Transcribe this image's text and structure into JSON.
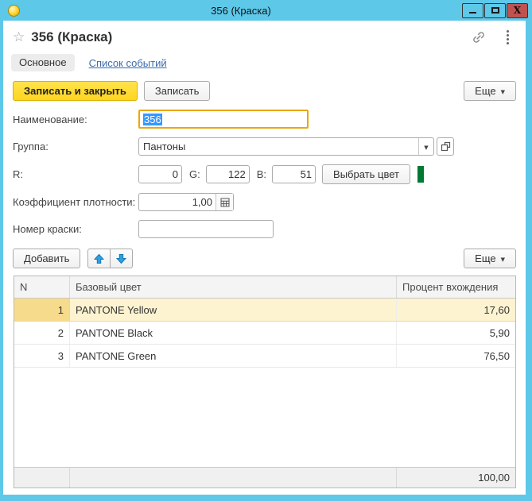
{
  "window": {
    "title": "356 (Краска)"
  },
  "header": {
    "title": "356 (Краска)"
  },
  "icons": {
    "star": "☆",
    "caret": "▼"
  },
  "tabs": [
    {
      "label": "Основное"
    },
    {
      "label": "Список событий"
    }
  ],
  "command_bar": {
    "save_and_close": "Записать и закрыть",
    "save": "Записать",
    "more": "Еще"
  },
  "form": {
    "fields": {
      "name": {
        "label": "Наименование:",
        "value": "356"
      },
      "group": {
        "label": "Группа:",
        "value": "Пантоны"
      },
      "r": {
        "label": "R:",
        "value": "0"
      },
      "g": {
        "label": "G:",
        "value": "122"
      },
      "b": {
        "label": "B:",
        "value": "51"
      },
      "pick_color_button": "Выбрать цвет",
      "swatch_color": "#007a33",
      "density": {
        "label": "Коэффициент плотности:",
        "value": "1,00"
      },
      "paint_number": {
        "label": "Номер краски:",
        "value": ""
      }
    }
  },
  "table_toolbar": {
    "add": "Добавить",
    "more": "Еще"
  },
  "table": {
    "columns": [
      "N",
      "Базовый цвет",
      "Процент вхождения"
    ],
    "rows": [
      {
        "n": "1",
        "color": "PANTONE Yellow",
        "percent": "17,60"
      },
      {
        "n": "2",
        "color": "PANTONE Black",
        "percent": "5,90"
      },
      {
        "n": "3",
        "color": "PANTONE Green",
        "percent": "76,50"
      }
    ],
    "total": "100,00"
  }
}
